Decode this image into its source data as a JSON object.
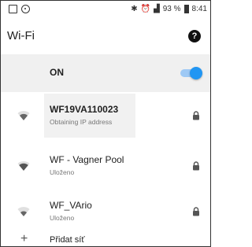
{
  "status_bar": {
    "battery_percent": "93 %",
    "time": "8:41"
  },
  "header": {
    "title": "Wi-Fi",
    "help_icon": "help-circle-icon"
  },
  "wifi_toggle": {
    "label": "ON",
    "enabled": true,
    "accent_color": "#2196f3"
  },
  "networks": [
    {
      "name": "WF19VA110023",
      "status": "Obtaining IP address",
      "secured": true,
      "signal": "strong",
      "bold": true
    },
    {
      "name": "WF - Vagner Pool",
      "status": "Uloženo",
      "secured": true,
      "signal": "strong",
      "bold": false
    },
    {
      "name": "WF_VArio",
      "status": "Uloženo",
      "secured": true,
      "signal": "medium",
      "bold": false
    }
  ],
  "add_network": {
    "label": "Přidat síť"
  }
}
